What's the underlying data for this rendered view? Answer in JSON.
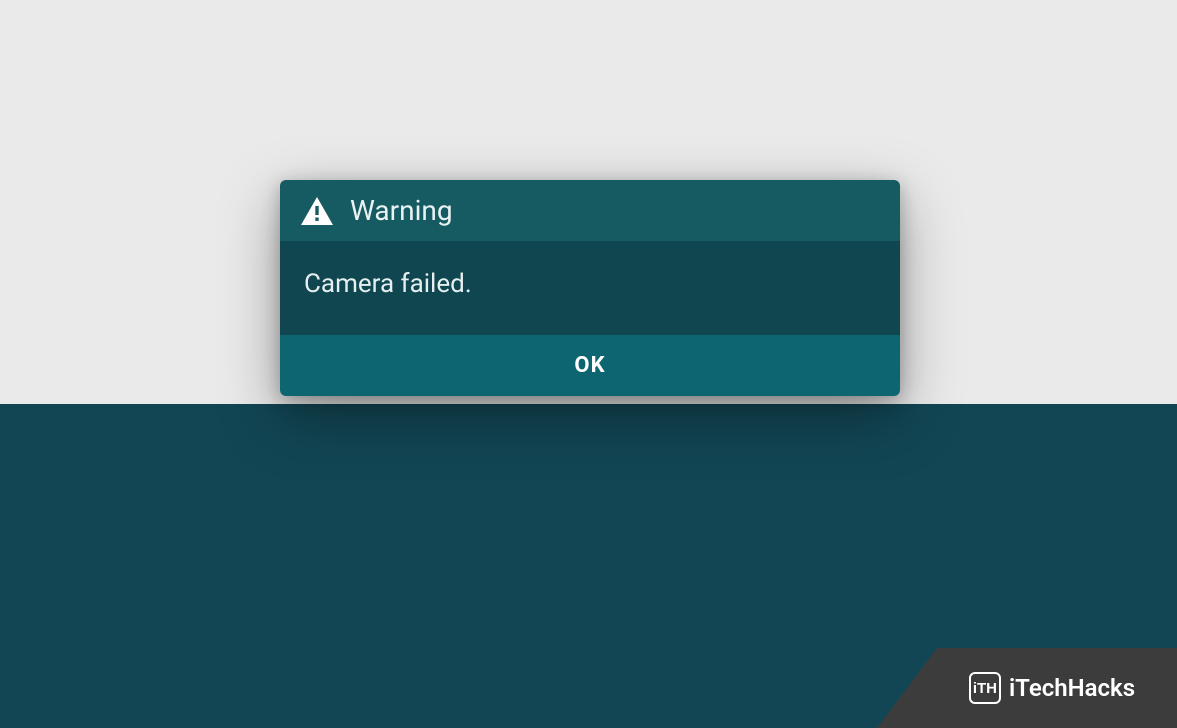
{
  "dialog": {
    "title": "Warning",
    "message": "Camera failed.",
    "ok_label": "OK"
  },
  "watermark": {
    "logo_text": "iTH",
    "brand": "iTechHacks"
  }
}
